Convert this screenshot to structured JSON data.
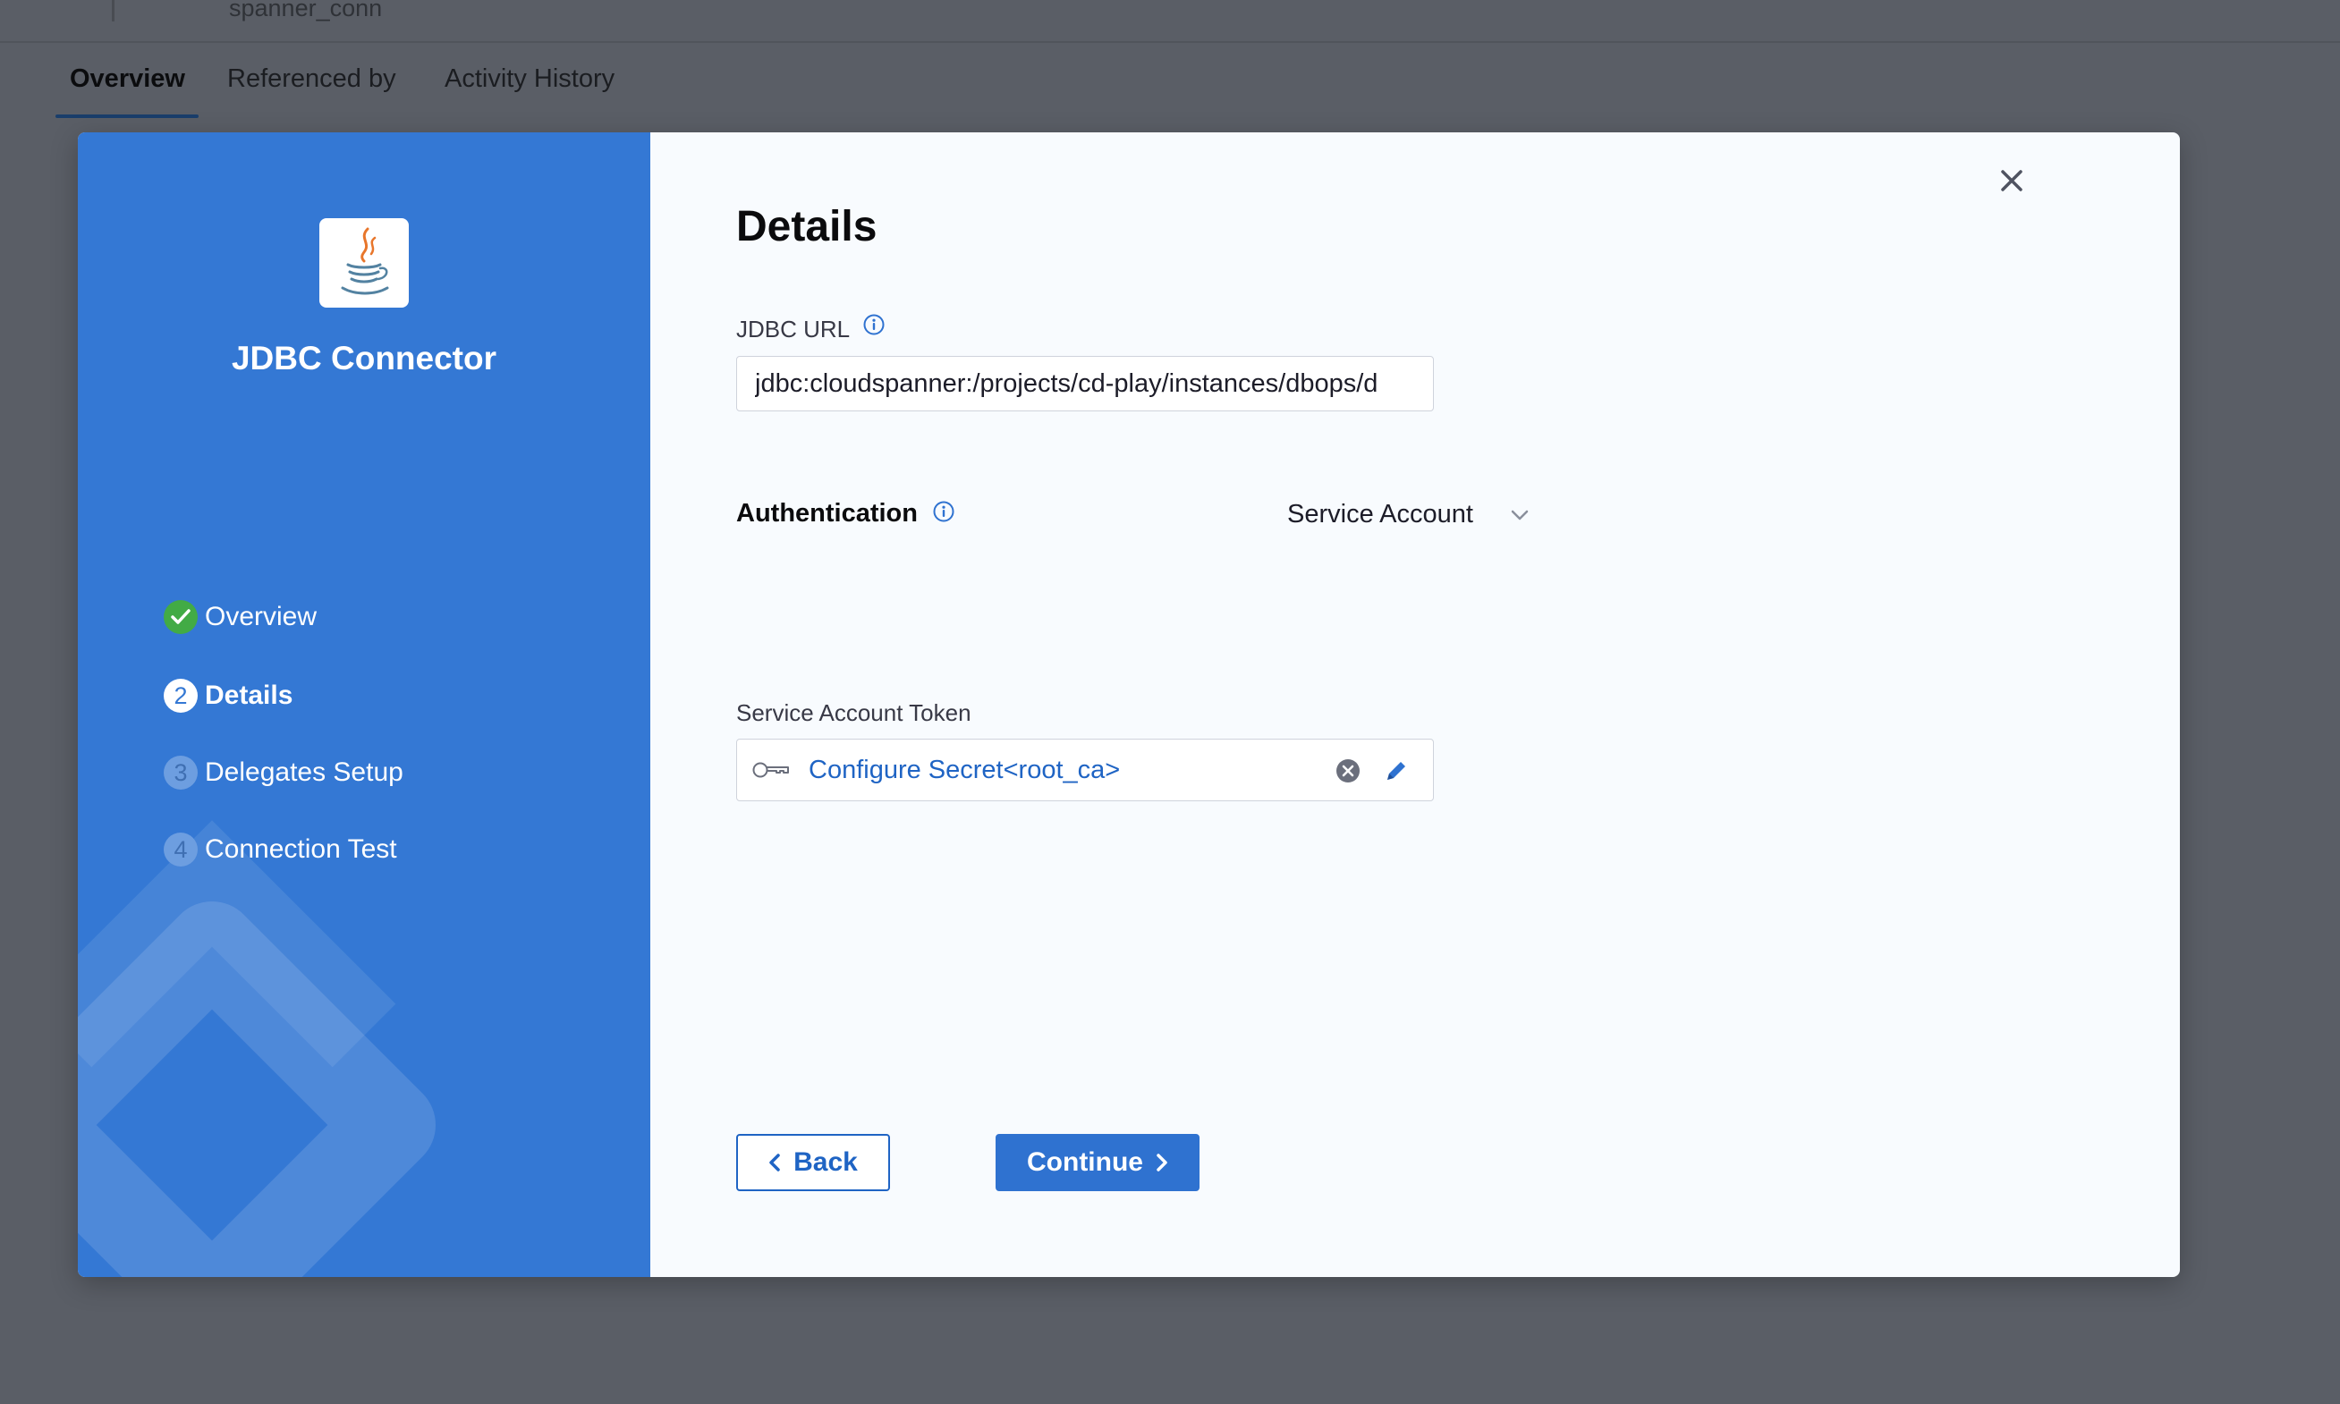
{
  "background": {
    "connector_name": "spanner_conn",
    "tabs": [
      {
        "label": "Overview"
      },
      {
        "label": "Referenced by"
      },
      {
        "label": "Activity History"
      }
    ]
  },
  "wizard": {
    "title": "JDBC Connector",
    "logo_icon": "java-icon",
    "steps": [
      {
        "label": "Overview",
        "state": "done",
        "number": "1"
      },
      {
        "label": "Details",
        "state": "current",
        "number": "2"
      },
      {
        "label": "Delegates Setup",
        "state": "pending",
        "number": "3"
      },
      {
        "label": "Connection Test",
        "state": "pending",
        "number": "4"
      }
    ]
  },
  "details": {
    "heading": "Details",
    "jdbc_url_label": "JDBC URL",
    "jdbc_url_value": "jdbc:cloudspanner:/projects/cd-play/instances/dbops/d",
    "authentication_label": "Authentication",
    "authentication_value": "Service Account",
    "token_label": "Service Account Token",
    "token_value": "Configure Secret<root_ca>"
  },
  "buttons": {
    "back": "Back",
    "continue": "Continue"
  },
  "colors": {
    "sidebar": "#3478d4",
    "accent": "#1f64c4",
    "success": "#42ab45",
    "overlay": "#5a5e66"
  }
}
